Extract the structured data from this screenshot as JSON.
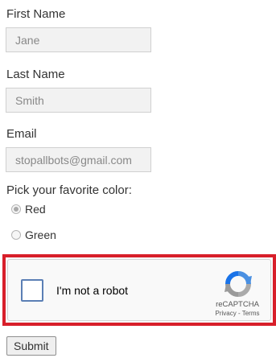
{
  "form": {
    "first_name": {
      "label": "First Name",
      "value": "Jane"
    },
    "last_name": {
      "label": "Last Name",
      "value": "Smith"
    },
    "email": {
      "label": "Email",
      "value": "stopallbots@gmail.com"
    },
    "color": {
      "question": "Pick your favorite color:",
      "options": [
        {
          "label": "Red",
          "selected": true
        },
        {
          "label": "Green",
          "selected": false
        }
      ]
    },
    "submit_label": "Submit"
  },
  "captcha": {
    "checkbox_label": "I'm not a robot",
    "brand": "reCAPTCHA",
    "privacy": "Privacy",
    "separator": " - ",
    "terms": "Terms",
    "logo_icon": "recaptcha-logo-icon",
    "frame_color": "#d81f2a"
  }
}
